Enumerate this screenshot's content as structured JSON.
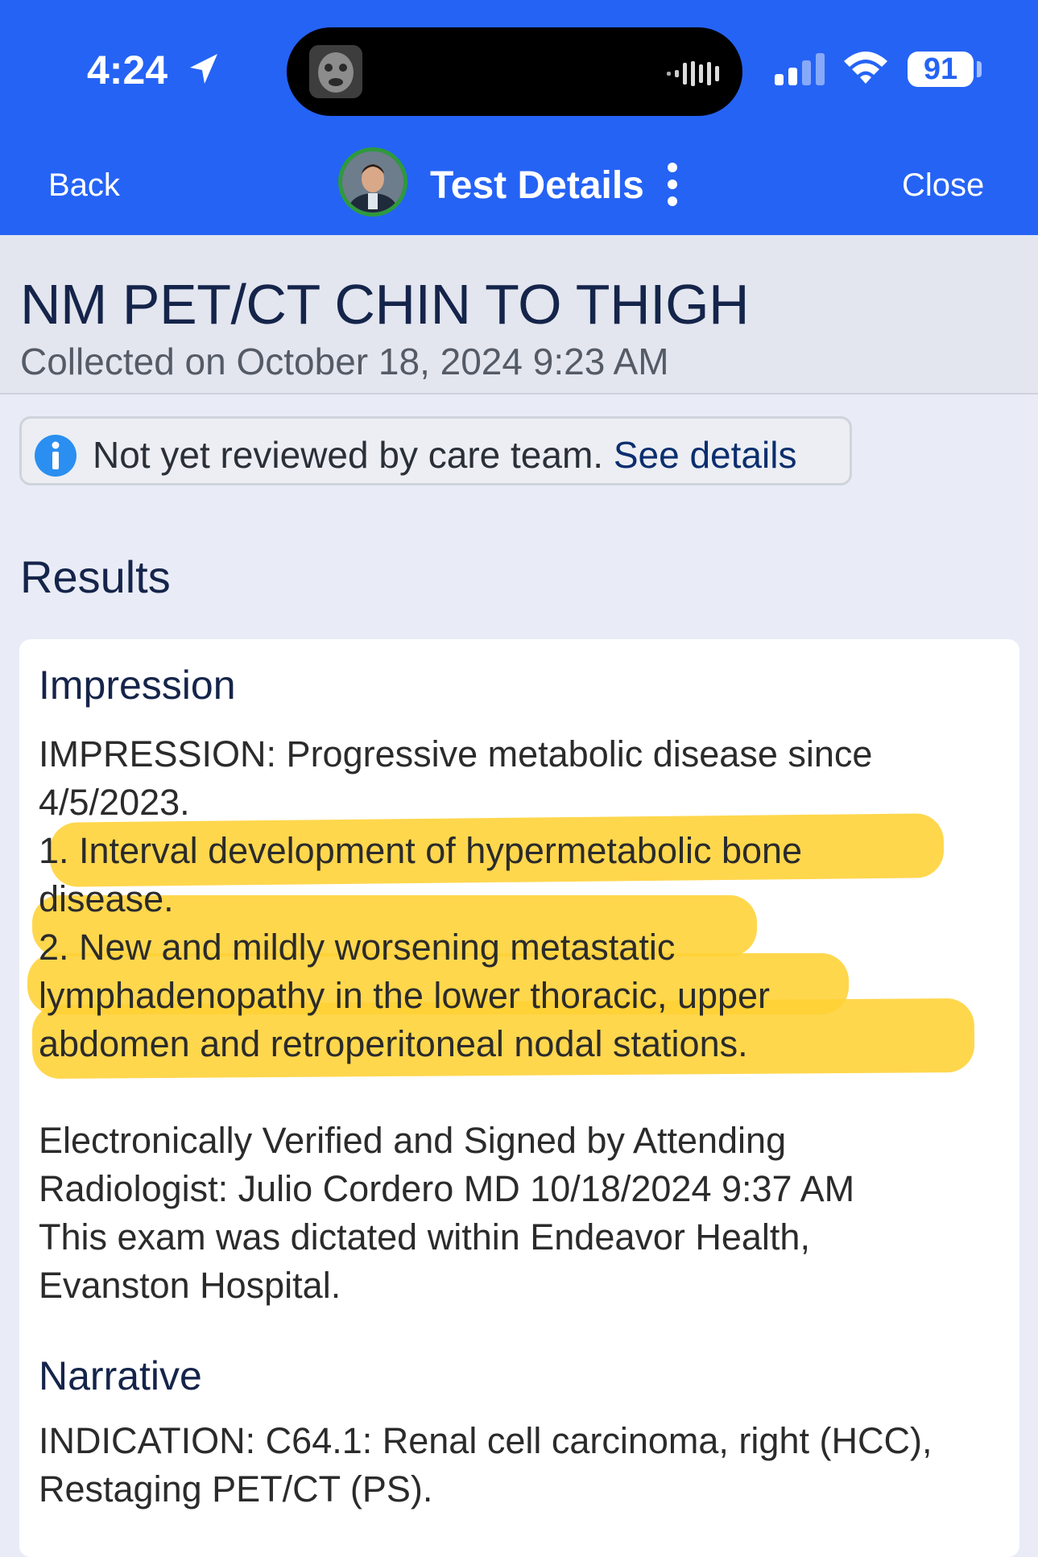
{
  "status_bar": {
    "time": "4:24",
    "battery": "91",
    "location_icon": "location-arrow-icon",
    "signal_icon": "cellular-signal-icon",
    "wifi_icon": "wifi-icon"
  },
  "nav": {
    "back_label": "Back",
    "title": "Test Details",
    "close_label": "Close",
    "more_icon": "more-vertical-icon"
  },
  "test": {
    "title": "NM PET/CT CHIN TO THIGH",
    "collected": "Collected on October 18, 2024 9:23 AM"
  },
  "notice": {
    "text": "Not yet reviewed by care team.",
    "link": "See details",
    "icon": "info-icon"
  },
  "results": {
    "heading": "Results",
    "impression": {
      "title": "Impression",
      "lines": [
        "IMPRESSION: Progressive metabolic disease since",
        "4/5/2023.",
        "1. Interval development of hypermetabolic bone",
        "disease.",
        "2. New and mildly worsening metastatic",
        "lymphadenopathy in the lower thoracic, upper",
        "abdomen and retroperitoneal nodal stations."
      ],
      "signature_lines": [
        "Electronically Verified and Signed by Attending",
        "Radiologist: Julio Cordero MD 10/18/2024 9:37 AM",
        "This exam was dictated within Endeavor Health,",
        "Evanston Hospital."
      ]
    },
    "narrative": {
      "title": "Narrative",
      "lines": [
        "INDICATION: C64.1: Renal cell carcinoma, right (HCC),",
        "Restaging PET/CT (PS)."
      ]
    }
  },
  "colors": {
    "header_blue": "#2563f5",
    "highlight_yellow": "#ffd234",
    "title_navy": "#15244a"
  }
}
